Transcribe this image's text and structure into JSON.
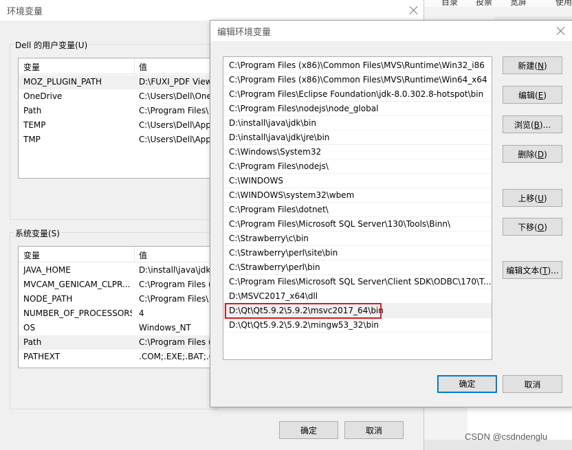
{
  "background": {
    "menu_items": [
      "目录",
      "投票",
      "宽屏",
      "使用"
    ],
    "watermark": "CSDN @csdndenglu"
  },
  "env_dialog": {
    "title": "环境变量",
    "user_group_label": "Dell 的用户变量(U)",
    "columns": {
      "name": "变量",
      "value": "值"
    },
    "user_vars": [
      {
        "name": "MOZ_PLUGIN_PATH",
        "value": "D:\\FUXI_PDF View"
      },
      {
        "name": "OneDrive",
        "value": "C:\\Users\\Dell\\One"
      },
      {
        "name": "Path",
        "value": "C:\\Program Files\\"
      },
      {
        "name": "TEMP",
        "value": "C:\\Users\\Dell\\App"
      },
      {
        "name": "TMP",
        "value": "C:\\Users\\Dell\\App"
      }
    ],
    "system_group_label": "系统变量(S)",
    "system_vars": [
      {
        "name": "JAVA_HOME",
        "value": "D:\\install\\java\\jdk"
      },
      {
        "name": "MVCAM_GENICAM_CLPR...",
        "value": "C:\\Program Files ("
      },
      {
        "name": "NODE_PATH",
        "value": "C:\\Program Files\\"
      },
      {
        "name": "NUMBER_OF_PROCESSORS",
        "value": "4"
      },
      {
        "name": "OS",
        "value": "Windows_NT"
      },
      {
        "name": "Path",
        "value": "C:\\Program Files ("
      },
      {
        "name": "PATHEXT",
        "value": ".COM;.EXE;.BAT;.C"
      }
    ],
    "ok_label": "确定",
    "cancel_label": "取消"
  },
  "edit_dialog": {
    "title": "编辑环境变量",
    "paths": [
      "C:\\Program Files (x86)\\Common Files\\MVS\\Runtime\\Win32_i86",
      "C:\\Program Files (x86)\\Common Files\\MVS\\Runtime\\Win64_x64",
      "C:\\Program Files\\Eclipse Foundation\\jdk-8.0.302.8-hotspot\\bin",
      "C:\\Program Files\\nodejs\\node_global",
      "D:\\install\\java\\jdk\\bin",
      "D:\\install\\java\\jdk\\jre\\bin",
      "C:\\Windows\\System32",
      "C:\\Program Files\\nodejs\\",
      "C:\\WINDOWS",
      "C:\\WINDOWS\\system32\\wbem",
      "C:\\Program Files\\dotnet\\",
      "C:\\Program Files\\Microsoft SQL Server\\130\\Tools\\Binn\\",
      "C:\\Strawberry\\c\\bin",
      "C:\\Strawberry\\perl\\site\\bin",
      "C:\\Strawberry\\perl\\bin",
      "C:\\Program Files\\Microsoft SQL Server\\Client SDK\\ODBC\\170\\T...",
      "D:\\MSVC2017_x64\\dll",
      "D:\\Qt\\Qt5.9.2\\5.9.2\\msvc2017_64\\bin",
      "D:\\Qt\\Qt5.9.2\\5.9.2\\mingw53_32\\bin"
    ],
    "buttons": {
      "new": {
        "text": "新建(",
        "key": "N",
        "tail": ")"
      },
      "edit": {
        "text": "编辑(",
        "key": "E",
        "tail": ")"
      },
      "browse": {
        "text": "浏览(",
        "key": "B",
        "tail": ")..."
      },
      "delete": {
        "text": "删除(",
        "key": "D",
        "tail": ")"
      },
      "up": {
        "text": "上移(",
        "key": "U",
        "tail": ")"
      },
      "down": {
        "text": "下移(",
        "key": "O",
        "tail": ")"
      },
      "edit_text": {
        "text": "编辑文本(",
        "key": "T",
        "tail": ")..."
      }
    },
    "ok_label": "确定",
    "cancel_label": "取消",
    "accent_color": "#e0161b"
  }
}
